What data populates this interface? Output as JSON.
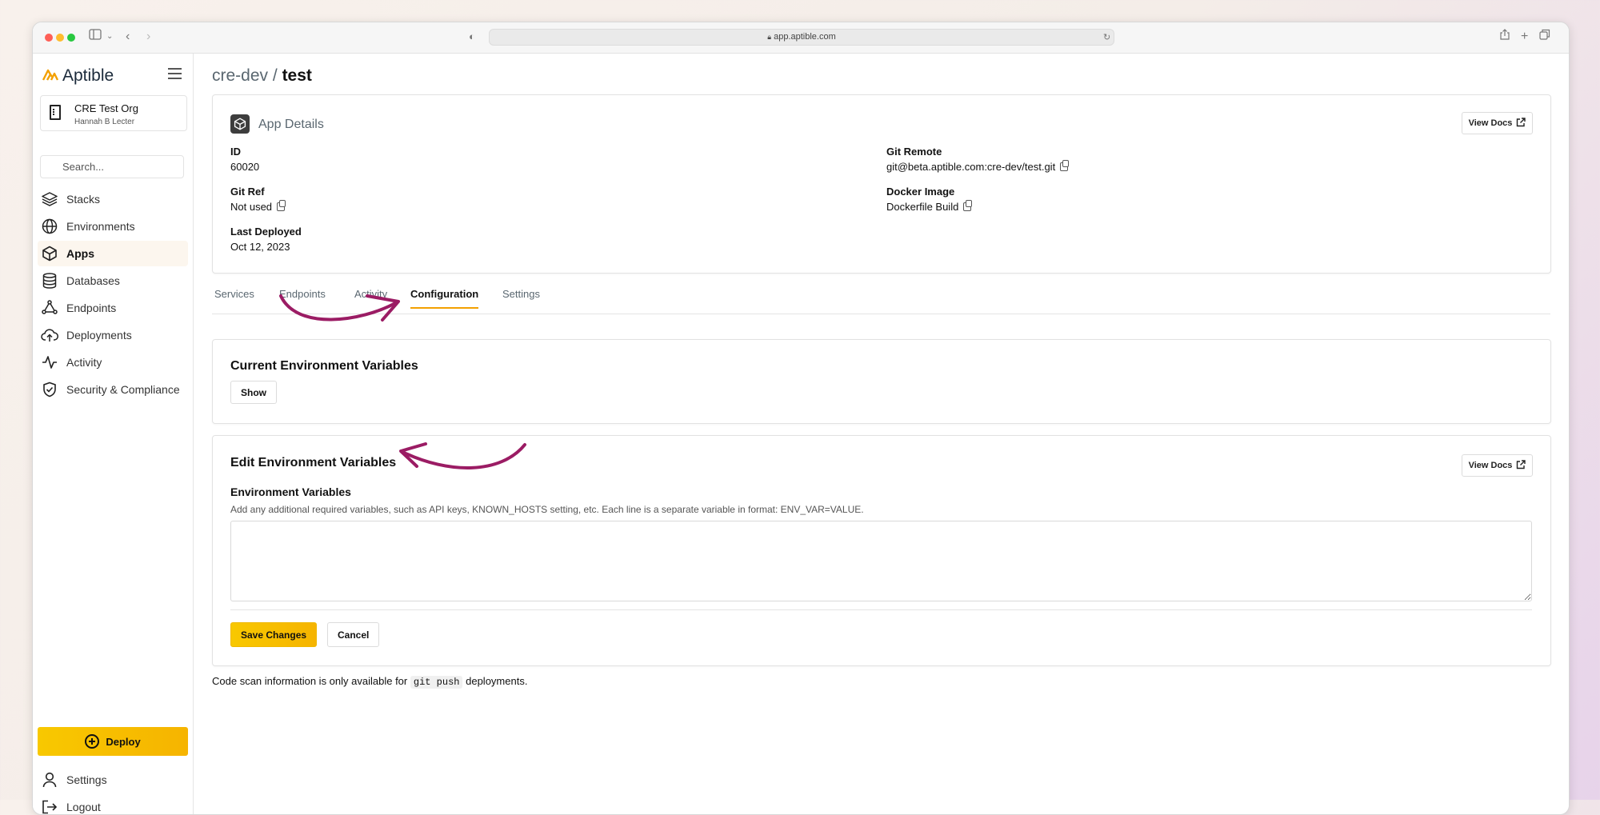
{
  "browser": {
    "url": "app.aptible.com"
  },
  "sidebar": {
    "logo_text": "Aptible",
    "org": {
      "name": "CRE Test Org",
      "user": "Hannah B Lecter"
    },
    "search_placeholder": "Search...",
    "items": [
      {
        "label": "Stacks",
        "icon": "layers-icon"
      },
      {
        "label": "Environments",
        "icon": "globe-icon"
      },
      {
        "label": "Apps",
        "icon": "cube-icon",
        "active": true
      },
      {
        "label": "Databases",
        "icon": "database-icon"
      },
      {
        "label": "Endpoints",
        "icon": "endpoints-icon"
      },
      {
        "label": "Deployments",
        "icon": "cloud-upload-icon"
      },
      {
        "label": "Activity",
        "icon": "activity-icon"
      },
      {
        "label": "Security & Compliance",
        "icon": "shield-check-icon"
      }
    ],
    "deploy_label": "Deploy",
    "bottom_items": [
      {
        "label": "Settings",
        "icon": "user-icon"
      },
      {
        "label": "Logout",
        "icon": "logout-icon"
      }
    ]
  },
  "breadcrumb": {
    "env": "cre-dev",
    "separator": "/",
    "app": "test"
  },
  "app_details": {
    "title": "App Details",
    "view_docs": "View Docs",
    "fields": {
      "id": {
        "label": "ID",
        "value": "60020"
      },
      "git_ref": {
        "label": "Git Ref",
        "value": "Not used"
      },
      "last_deployed": {
        "label": "Last Deployed",
        "value": "Oct 12, 2023"
      },
      "git_remote": {
        "label": "Git Remote",
        "value": "git@beta.aptible.com:cre-dev/test.git"
      },
      "docker_image": {
        "label": "Docker Image",
        "value": "Dockerfile Build"
      }
    }
  },
  "tabs": [
    {
      "label": "Services"
    },
    {
      "label": "Endpoints"
    },
    {
      "label": "Activity"
    },
    {
      "label": "Configuration",
      "active": true
    },
    {
      "label": "Settings"
    }
  ],
  "current_env": {
    "title": "Current Environment Variables",
    "show_label": "Show"
  },
  "edit_env": {
    "title": "Edit Environment Variables",
    "view_docs": "View Docs",
    "field_label": "Environment Variables",
    "help_text": "Add any additional required variables, such as API keys, KNOWN_HOSTS setting, etc. Each line is a separate variable in format: ENV_VAR=VALUE.",
    "value": "",
    "save_label": "Save Changes",
    "cancel_label": "Cancel"
  },
  "footnote": {
    "before": "Code scan information is only available for",
    "code": "git push",
    "after": "deployments."
  },
  "colors": {
    "accent": "#f3a000",
    "deploy": "#f8c800",
    "annotation": "#9b1c64"
  }
}
